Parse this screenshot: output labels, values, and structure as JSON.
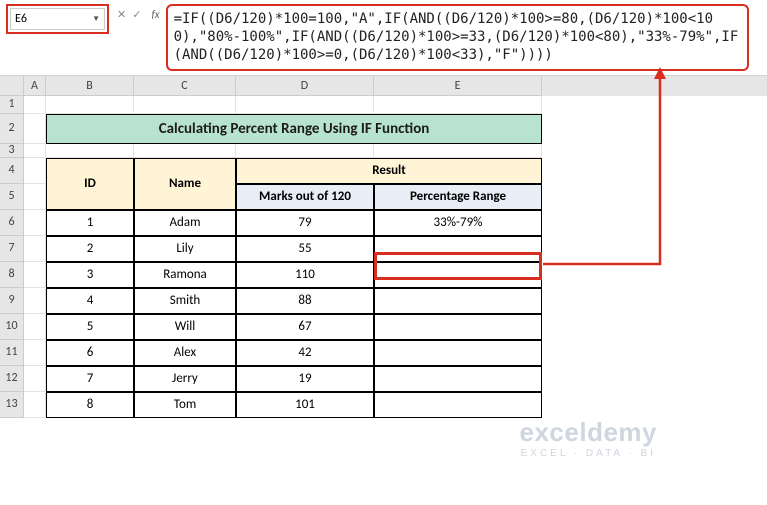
{
  "name_box": "E6",
  "formula": "=IF((D6/120)*100=100,\"A\",IF(AND((D6/120)*100>=80,(D6/120)*100<100),\"80%-100%\",IF(AND((D6/120)*100>=33,(D6/120)*100<80),\"33%-79%\",IF(AND((D6/120)*100>=0,(D6/120)*100<33),\"F\"))))",
  "title": "Calculating Percent Range Using IF Function",
  "headers": {
    "id": "ID",
    "name": "Name",
    "result": "Result",
    "marks": "Marks out of 120",
    "range": "Percentage Range"
  },
  "rows": [
    {
      "id": "1",
      "name": "Adam",
      "marks": "79",
      "range": "33%-79%"
    },
    {
      "id": "2",
      "name": "Lily",
      "marks": "55",
      "range": ""
    },
    {
      "id": "3",
      "name": "Ramona",
      "marks": "110",
      "range": ""
    },
    {
      "id": "4",
      "name": "Smith",
      "marks": "88",
      "range": ""
    },
    {
      "id": "5",
      "name": "Will",
      "marks": "67",
      "range": ""
    },
    {
      "id": "6",
      "name": "Alex",
      "marks": "42",
      "range": ""
    },
    {
      "id": "7",
      "name": "Jerry",
      "marks": "19",
      "range": ""
    },
    {
      "id": "8",
      "name": "Tom",
      "marks": "101",
      "range": ""
    }
  ],
  "cols": [
    "A",
    "B",
    "C",
    "D",
    "E"
  ],
  "row_nums": [
    "1",
    "2",
    "3",
    "4",
    "5",
    "6",
    "7",
    "8",
    "9",
    "10",
    "11",
    "12",
    "13"
  ],
  "fx": "fx",
  "watermark": {
    "big": "exceldemy",
    "small": "EXCEL · DATA · BI"
  },
  "chart_data": {
    "type": "table",
    "title": "Calculating Percent Range Using IF Function",
    "columns": [
      "ID",
      "Name",
      "Marks out of 120",
      "Percentage Range"
    ],
    "data": [
      [
        1,
        "Adam",
        79,
        "33%-79%"
      ],
      [
        2,
        "Lily",
        55,
        ""
      ],
      [
        3,
        "Ramona",
        110,
        ""
      ],
      [
        4,
        "Smith",
        88,
        ""
      ],
      [
        5,
        "Will",
        67,
        ""
      ],
      [
        6,
        "Alex",
        42,
        ""
      ],
      [
        7,
        "Jerry",
        19,
        ""
      ],
      [
        8,
        "Tom",
        101,
        ""
      ]
    ]
  }
}
